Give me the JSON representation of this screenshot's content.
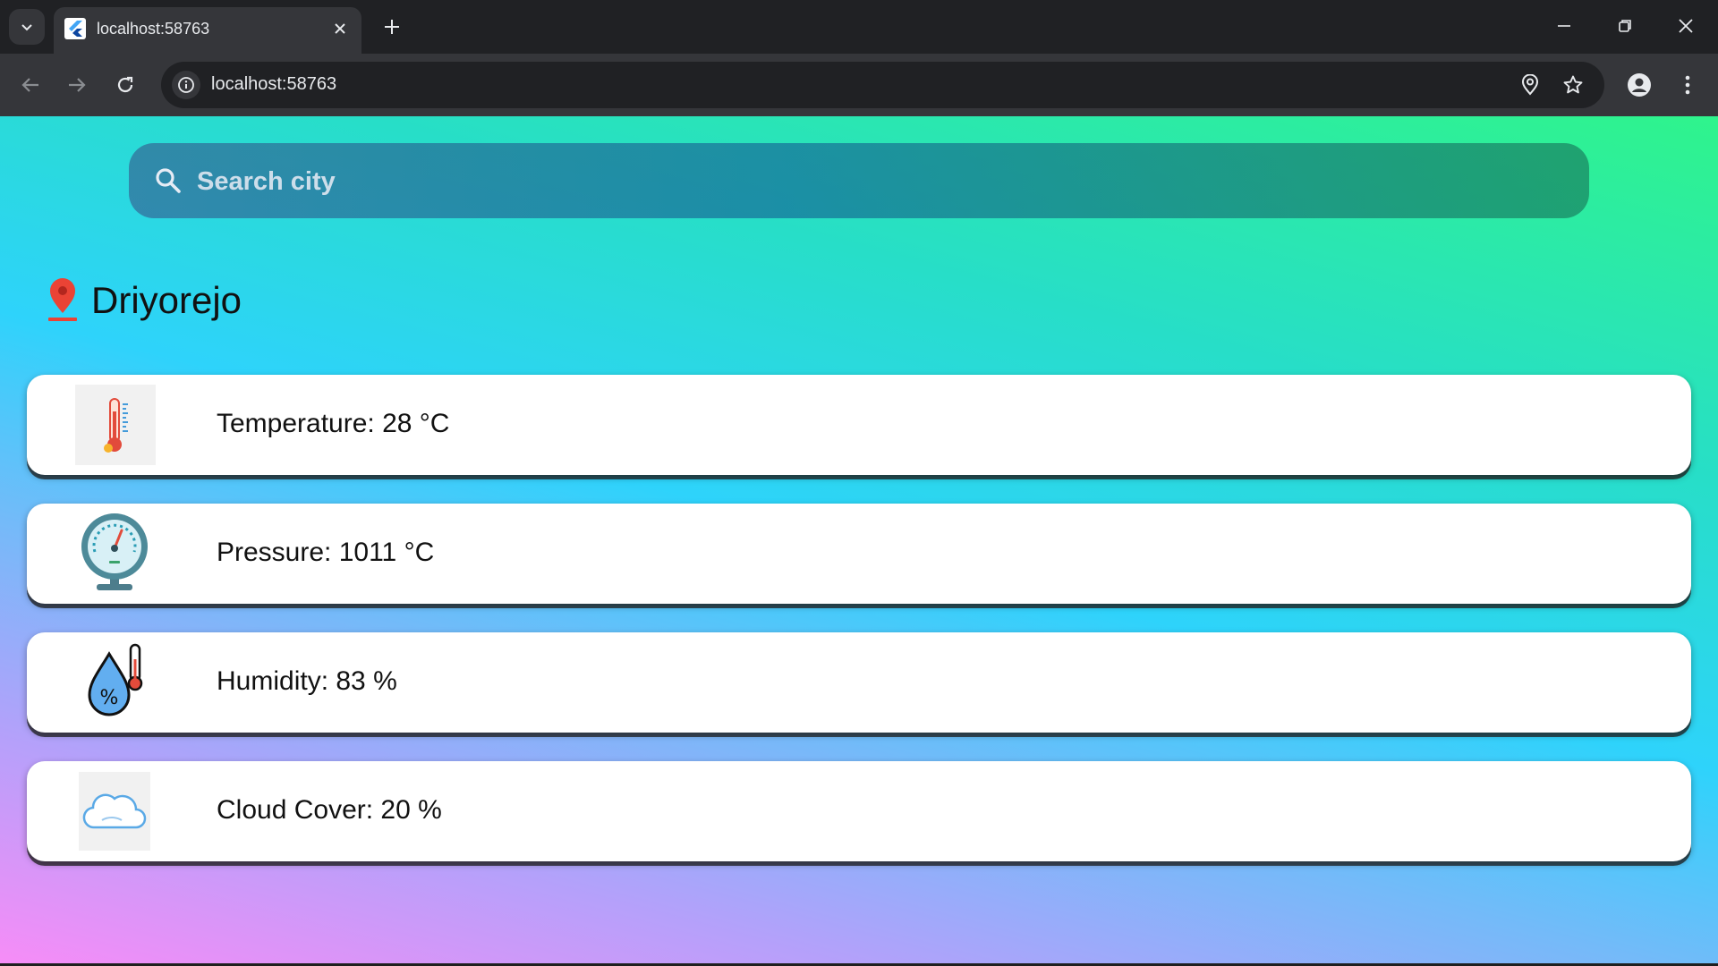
{
  "browser": {
    "tab_title": "localhost:58763",
    "url": "localhost:58763"
  },
  "search": {
    "placeholder": "Search city"
  },
  "location": {
    "city": "Driyorejo"
  },
  "cards": [
    {
      "label": "Temperature: ",
      "value": "28",
      "unit": " °C"
    },
    {
      "label": "Pressure: ",
      "value": "1011",
      "unit": " °C"
    },
    {
      "label": "Humidity: ",
      "value": "83",
      "unit": " %"
    },
    {
      "label": "Cloud Cover: ",
      "value": "20",
      "unit": " %"
    }
  ],
  "colors": {
    "chrome_dark": "#202124",
    "chrome_toolbar": "#35363a",
    "pin_red": "#ea4335",
    "card_bg": "#ffffff"
  }
}
